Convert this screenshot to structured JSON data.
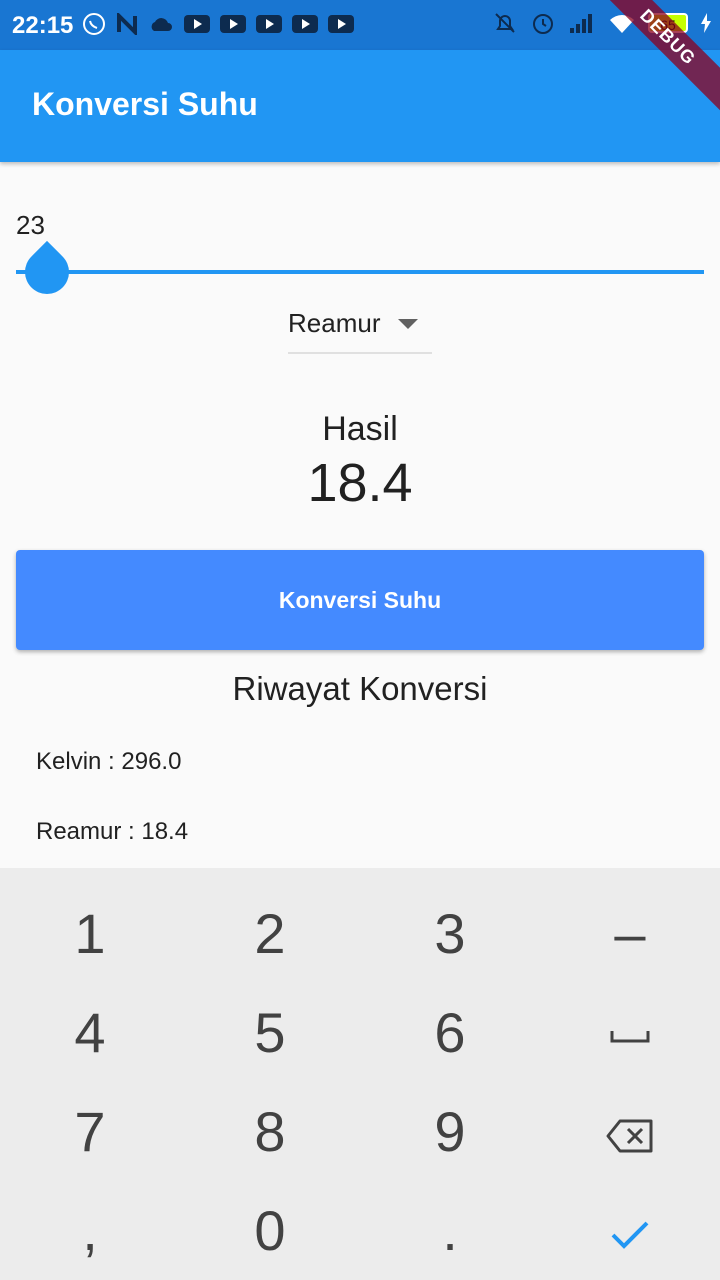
{
  "status_bar": {
    "time": "22:15",
    "battery": "65"
  },
  "app_bar": {
    "title": "Konversi Suhu",
    "debug_banner": "DEBUG"
  },
  "slider": {
    "value_label": "23",
    "level_fraction": 0.023
  },
  "dropdown": {
    "selected": "Reamur"
  },
  "result": {
    "label": "Hasil",
    "value": "18.4"
  },
  "convert_button": {
    "label": "Konversi Suhu"
  },
  "history": {
    "title": "Riwayat Konversi",
    "items": [
      "Kelvin : 296.0",
      "Reamur : 18.4"
    ]
  },
  "keyboard": {
    "keys": {
      "k1": "1",
      "k2": "2",
      "k3": "3",
      "minus": "–",
      "k4": "4",
      "k5": "5",
      "k6": "6",
      "k7": "7",
      "k8": "8",
      "k9": "9",
      "comma": ",",
      "k0": "0",
      "period": "."
    },
    "icons": {
      "space": "space-icon",
      "backspace": "backspace-icon",
      "done": "check-icon"
    },
    "accent": "#2196f3"
  },
  "colors": {
    "status_bar": "#1976d2",
    "app_bar": "#2196f3",
    "button": "#448aff"
  }
}
